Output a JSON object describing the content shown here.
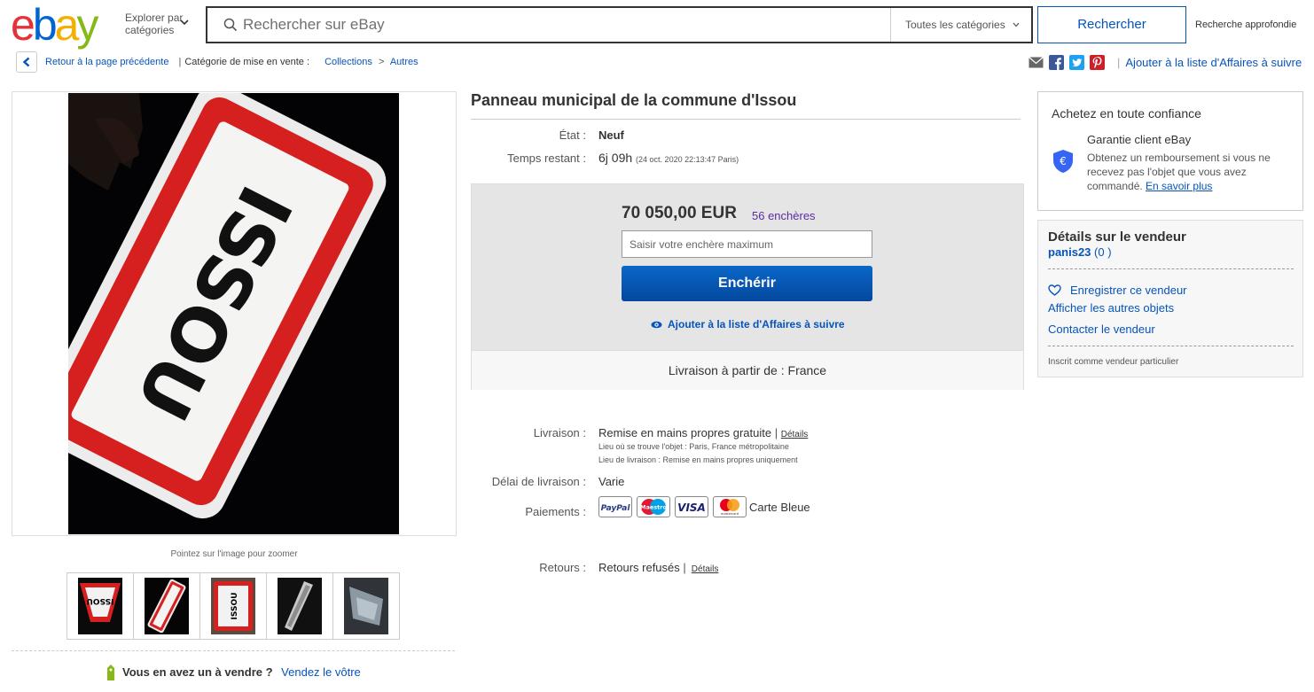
{
  "header": {
    "logo_letters": [
      "e",
      "b",
      "a",
      "y"
    ],
    "explore_line1": "Explorer par",
    "explore_line2": "catégories",
    "search_placeholder": "Rechercher sur eBay",
    "category_select": "Toutes les catégories",
    "search_button": "Rechercher",
    "advanced_search": "Recherche approfondie"
  },
  "breadcrumb": {
    "back_label": "Retour à la page précédente",
    "category_label": "Catégorie de mise en vente :",
    "path": [
      "Collections",
      "Autres"
    ],
    "separator": "|",
    "arrow": ">"
  },
  "share": {
    "icons": [
      "email-icon",
      "facebook-icon",
      "twitter-icon",
      "pinterest-icon"
    ],
    "watch_label": "Ajouter à la liste d'Affaires à suivre"
  },
  "gallery": {
    "zoom_hint": "Pointez sur l'image pour zoomer",
    "main_sign_text": "ISSOU",
    "thumbnails": [
      "issou-sign-photo-1",
      "issou-sign-photo-2",
      "issou-sign-photo-3",
      "issou-sign-photo-4",
      "issou-sign-photo-5"
    ],
    "thumb_sign_text": "ISSOU",
    "sell_question": "Vous en avez un à vendre ?",
    "sell_link": "Vendez le vôtre"
  },
  "item": {
    "title": "Panneau municipal de la commune d'Issou",
    "condition_label": "État :",
    "condition_value": "Neuf",
    "time_label": "Temps restant :",
    "time_value": "6j 09h",
    "time_detail": "(24 oct. 2020   22:13:47 Paris)"
  },
  "bid": {
    "price": "70 050,00 EUR",
    "bid_count": "56 enchères",
    "input_placeholder": "Saisir votre enchère maximum",
    "bid_button": "Enchérir",
    "watch_label": "Ajouter à la liste d'Affaires à suivre",
    "shipping_from": "Livraison à partir de : France"
  },
  "details": {
    "delivery_label": "Livraison :",
    "delivery_value": "Remise en mains propres gratuite",
    "delivery_sep": "|",
    "delivery_details": "Détails",
    "location_line": "Lieu où se trouve l'objet :  Paris, France métropolitaine",
    "delivery_place_line": "Lieu de livraison :  Remise en mains propres uniquement",
    "delay_label": "Délai de livraison :",
    "delay_value": "Varie",
    "payments_label": "Paiements :",
    "payment_badges": [
      "PayPal",
      "Maestro",
      "VISA",
      "mastercard"
    ],
    "payment_extra": "Carte Bleue",
    "returns_label": "Retours :",
    "returns_value": "Retours refusés",
    "returns_sep": "|",
    "returns_details": "Détails"
  },
  "trust": {
    "title": "Achetez en toute confiance",
    "guarantee_title": "Garantie client eBay",
    "guarantee_text": "Obtenez un remboursement si vous ne recevez pas l'objet que vous avez commandé.",
    "guarantee_link": "En savoir plus"
  },
  "seller": {
    "title": "Détails sur le vendeur",
    "name": "panis23",
    "feedback": "(0 )",
    "save_seller": "Enregistrer ce vendeur",
    "other_items": "Afficher les autres objets",
    "contact": "Contacter le vendeur",
    "registered_as": "Inscrit comme vendeur particulier"
  },
  "colors": {
    "link_blue": "#0654ba",
    "bid_purple": "#5a2d9e",
    "button_blue": "#0654ba",
    "sign_red": "#d62020"
  }
}
